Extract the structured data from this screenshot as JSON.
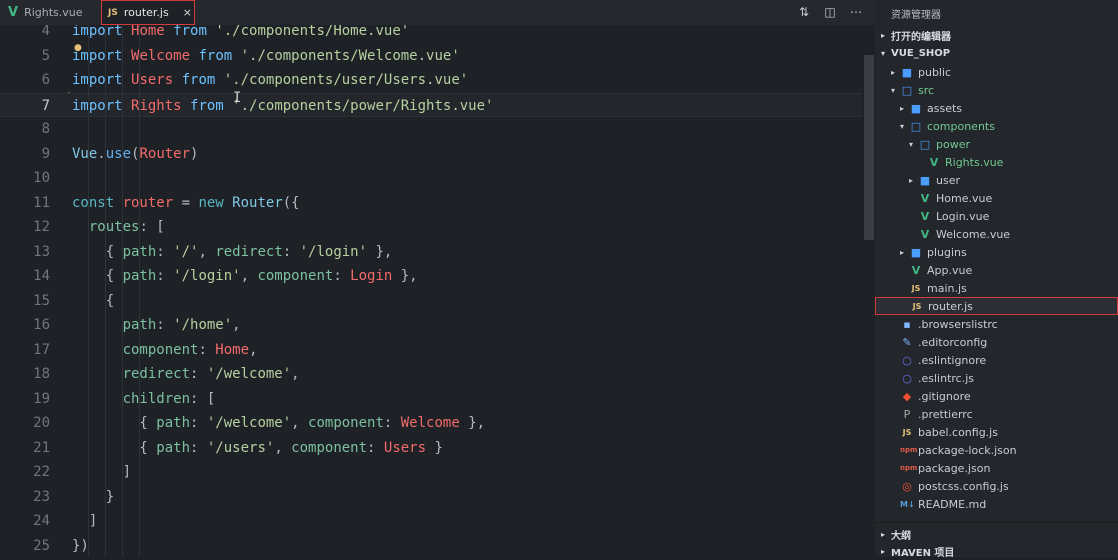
{
  "tabs": [
    {
      "label": "Rights.vue",
      "icon": "vue-icon",
      "active": false
    },
    {
      "label": "router.js",
      "icon": "js-icon",
      "active": true,
      "close": "×"
    }
  ],
  "toolbar_icons": [
    "compare-icon",
    "split-editor-icon",
    "more-icon"
  ],
  "editor": {
    "lines": [
      {
        "n": "4",
        "tokens": [
          [
            "kw",
            "import "
          ],
          [
            "id",
            "Home"
          ],
          [
            "kw",
            " from "
          ],
          [
            "str",
            "'./components/Home.vue'"
          ]
        ]
      },
      {
        "n": "5",
        "tokens": [
          [
            "kw",
            "import "
          ],
          [
            "id",
            "Welcome"
          ],
          [
            "kw",
            " from "
          ],
          [
            "str",
            "'./components/Welcome.vue'"
          ]
        ]
      },
      {
        "n": "6",
        "tokens": [
          [
            "kw",
            "import "
          ],
          [
            "id",
            "Users"
          ],
          [
            "kw",
            " from "
          ],
          [
            "str",
            "'./components/user/Users.vue'"
          ]
        ]
      },
      {
        "n": "7",
        "tokens": [
          [
            "kw",
            "import "
          ],
          [
            "id",
            "Rights"
          ],
          [
            "kw",
            " from "
          ],
          [
            "str",
            "'./components/power/Rights.vue'"
          ]
        ],
        "current": true
      },
      {
        "n": "8",
        "tokens": []
      },
      {
        "n": "9",
        "tokens": [
          [
            "cls",
            "Vue"
          ],
          [
            "punc",
            "."
          ],
          [
            "fn",
            "use"
          ],
          [
            "punc",
            "("
          ],
          [
            "id",
            "Router"
          ],
          [
            "punc",
            ")"
          ]
        ]
      },
      {
        "n": "10",
        "tokens": []
      },
      {
        "n": "11",
        "tokens": [
          [
            "kw2",
            "const "
          ],
          [
            "id",
            "router"
          ],
          [
            "punc",
            " = "
          ],
          [
            "kw2",
            "new "
          ],
          [
            "cls",
            "Router"
          ],
          [
            "punc",
            "({"
          ]
        ]
      },
      {
        "n": "12",
        "tokens": [
          [
            "prop",
            "  routes"
          ],
          [
            "punc",
            ": ["
          ]
        ]
      },
      {
        "n": "13",
        "tokens": [
          [
            "punc",
            "    { "
          ],
          [
            "prop",
            "path"
          ],
          [
            "punc",
            ": "
          ],
          [
            "str",
            "'/'"
          ],
          [
            "punc",
            ", "
          ],
          [
            "prop",
            "redirect"
          ],
          [
            "punc",
            ": "
          ],
          [
            "str",
            "'/login'"
          ],
          [
            "punc",
            " },"
          ]
        ]
      },
      {
        "n": "14",
        "tokens": [
          [
            "punc",
            "    { "
          ],
          [
            "prop",
            "path"
          ],
          [
            "punc",
            ": "
          ],
          [
            "str",
            "'/login'"
          ],
          [
            "punc",
            ", "
          ],
          [
            "prop",
            "component"
          ],
          [
            "punc",
            ": "
          ],
          [
            "id",
            "Login"
          ],
          [
            "punc",
            " },"
          ]
        ]
      },
      {
        "n": "15",
        "tokens": [
          [
            "punc",
            "    {"
          ]
        ]
      },
      {
        "n": "16",
        "tokens": [
          [
            "prop",
            "      path"
          ],
          [
            "punc",
            ": "
          ],
          [
            "str",
            "'/home'"
          ],
          [
            "punc",
            ","
          ]
        ]
      },
      {
        "n": "17",
        "tokens": [
          [
            "prop",
            "      component"
          ],
          [
            "punc",
            ": "
          ],
          [
            "id",
            "Home"
          ],
          [
            "punc",
            ","
          ]
        ]
      },
      {
        "n": "18",
        "tokens": [
          [
            "prop",
            "      redirect"
          ],
          [
            "punc",
            ": "
          ],
          [
            "str",
            "'/welcome'"
          ],
          [
            "punc",
            ","
          ]
        ]
      },
      {
        "n": "19",
        "tokens": [
          [
            "prop",
            "      children"
          ],
          [
            "punc",
            ": ["
          ]
        ]
      },
      {
        "n": "20",
        "tokens": [
          [
            "punc",
            "        { "
          ],
          [
            "prop",
            "path"
          ],
          [
            "punc",
            ": "
          ],
          [
            "str",
            "'/welcome'"
          ],
          [
            "punc",
            ", "
          ],
          [
            "prop",
            "component"
          ],
          [
            "punc",
            ": "
          ],
          [
            "id",
            "Welcome"
          ],
          [
            "punc",
            " },"
          ]
        ]
      },
      {
        "n": "21",
        "tokens": [
          [
            "punc",
            "        { "
          ],
          [
            "prop",
            "path"
          ],
          [
            "punc",
            ": "
          ],
          [
            "str",
            "'/users'"
          ],
          [
            "punc",
            ", "
          ],
          [
            "prop",
            "component"
          ],
          [
            "punc",
            ": "
          ],
          [
            "id",
            "Users"
          ],
          [
            "punc",
            " }"
          ]
        ]
      },
      {
        "n": "22",
        "tokens": [
          [
            "punc",
            "      ]"
          ]
        ]
      },
      {
        "n": "23",
        "tokens": [
          [
            "punc",
            "    }"
          ]
        ]
      },
      {
        "n": "24",
        "tokens": [
          [
            "punc",
            "  ]"
          ]
        ]
      },
      {
        "n": "25",
        "tokens": [
          [
            "punc",
            "})"
          ]
        ]
      }
    ]
  },
  "sidebar": {
    "title": "资源管理器",
    "open_editors": "打开的编辑器",
    "project": "VUE_SHOP",
    "tree": [
      {
        "label": "public",
        "icon": "folder-icon",
        "arrow": "▸",
        "depth": 1
      },
      {
        "label": "src",
        "icon": "folder-open-icon",
        "arrow": "▾",
        "depth": 1,
        "green": true
      },
      {
        "label": "assets",
        "icon": "folder-icon",
        "arrow": "▸",
        "depth": 2
      },
      {
        "label": "components",
        "icon": "folder-open-icon",
        "arrow": "▾",
        "depth": 2,
        "green": true,
        "dot": true
      },
      {
        "label": "power",
        "icon": "folder-open-icon",
        "arrow": "▾",
        "depth": 3,
        "green": true,
        "dot": true
      },
      {
        "label": "Rights.vue",
        "icon": "vue-icon",
        "arrow": "",
        "depth": 4,
        "green": true,
        "badge": "U"
      },
      {
        "label": "user",
        "icon": "folder-icon",
        "arrow": "▸",
        "depth": 3
      },
      {
        "label": "Home.vue",
        "icon": "vue-icon",
        "arrow": "",
        "depth": 3
      },
      {
        "label": "Login.vue",
        "icon": "vue-icon",
        "arrow": "",
        "depth": 3
      },
      {
        "label": "Welcome.vue",
        "icon": "vue-icon",
        "arrow": "",
        "depth": 3
      },
      {
        "label": "plugins",
        "icon": "folder-icon",
        "arrow": "▸",
        "depth": 2
      },
      {
        "label": "App.vue",
        "icon": "vue-icon",
        "arrow": "",
        "depth": 2
      },
      {
        "label": "main.js",
        "icon": "js-icon",
        "arrow": "",
        "depth": 2
      },
      {
        "label": "router.js",
        "icon": "js-icon",
        "arrow": "",
        "depth": 2,
        "selected": true
      },
      {
        "label": ".browserslistrc",
        "icon": "browserslist-icon",
        "arrow": "",
        "depth": 1
      },
      {
        "label": ".editorconfig",
        "icon": "editorconfig-icon",
        "arrow": "",
        "depth": 1
      },
      {
        "label": ".eslintignore",
        "icon": "eslint-icon",
        "arrow": "",
        "depth": 1
      },
      {
        "label": ".eslintrc.js",
        "icon": "eslint-icon",
        "arrow": "",
        "depth": 1
      },
      {
        "label": ".gitignore",
        "icon": "git-icon",
        "arrow": "",
        "depth": 1
      },
      {
        "label": ".prettierrc",
        "icon": "prettier-icon",
        "arrow": "",
        "depth": 1
      },
      {
        "label": "babel.config.js",
        "icon": "js-icon",
        "arrow": "",
        "depth": 1
      },
      {
        "label": "package-lock.json",
        "icon": "npm-icon",
        "arrow": "",
        "depth": 1
      },
      {
        "label": "package.json",
        "icon": "npm-icon",
        "arrow": "",
        "depth": 1
      },
      {
        "label": "postcss.config.js",
        "icon": "postcss-icon",
        "arrow": "",
        "depth": 1
      },
      {
        "label": "README.md",
        "icon": "markdown-icon",
        "arrow": "",
        "depth": 1
      }
    ],
    "outline": "大纲",
    "maven": "MAVEN 项目"
  }
}
